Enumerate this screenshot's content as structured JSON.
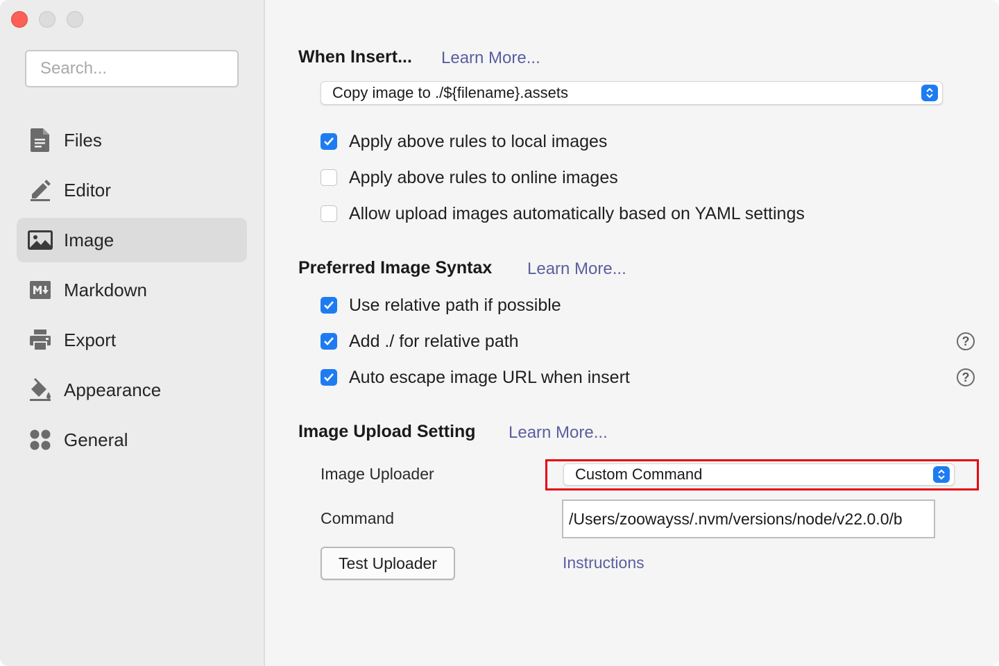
{
  "window": {
    "traffic_lights": [
      "close",
      "minimize",
      "maximize"
    ]
  },
  "sidebar": {
    "search_placeholder": "Search...",
    "items": [
      {
        "label": "Files",
        "icon": "file-icon",
        "active": false
      },
      {
        "label": "Editor",
        "icon": "pencil-icon",
        "active": false
      },
      {
        "label": "Image",
        "icon": "image-icon",
        "active": true
      },
      {
        "label": "Markdown",
        "icon": "markdown-icon",
        "active": false
      },
      {
        "label": "Export",
        "icon": "printer-icon",
        "active": false
      },
      {
        "label": "Appearance",
        "icon": "paint-bucket-icon",
        "active": false
      },
      {
        "label": "General",
        "icon": "grid-icon",
        "active": false
      }
    ]
  },
  "main": {
    "when_insert": {
      "title": "When Insert...",
      "learn_more": "Learn More...",
      "select_value": "Copy image to ./${filename}.assets",
      "options": [
        {
          "label": "Apply above rules to local images",
          "checked": true
        },
        {
          "label": "Apply above rules to online images",
          "checked": false
        },
        {
          "label": "Allow upload images automatically based on YAML settings",
          "checked": false
        }
      ]
    },
    "syntax": {
      "title": "Preferred Image Syntax",
      "learn_more": "Learn More...",
      "options": [
        {
          "label": "Use relative path if possible",
          "checked": true,
          "help": false
        },
        {
          "label": "Add ./ for relative path",
          "checked": true,
          "help": true
        },
        {
          "label": "Auto escape image URL when insert",
          "checked": true,
          "help": true
        }
      ]
    },
    "upload": {
      "title": "Image Upload Setting",
      "learn_more": "Learn More...",
      "uploader_label": "Image Uploader",
      "uploader_value": "Custom Command",
      "command_label": "Command",
      "command_value": "/Users/zoowayss/.nvm/versions/node/v22.0.0/b",
      "test_button": "Test Uploader",
      "instructions_link": "Instructions"
    }
  },
  "colors": {
    "accent": "#1e7cf2",
    "link": "#5a5f9f",
    "highlight": "#e8000b",
    "close": "#fe5f57"
  }
}
